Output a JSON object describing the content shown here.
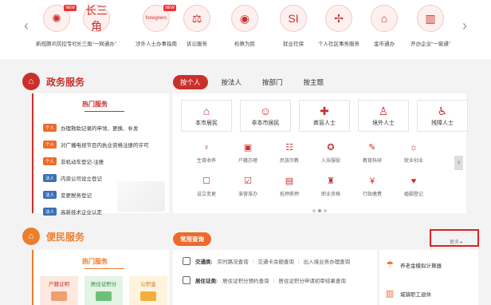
{
  "top_nav": {
    "prev_arrow": "‹",
    "next_arrow": "›",
    "items": [
      {
        "label": "新冠肺炎防控专栏",
        "icon": "virus-icon",
        "glyph": "✺",
        "badge": "NEW"
      },
      {
        "label": "长三角“一网通办”",
        "icon": "yangtze-delta-icon",
        "glyph": "长三角",
        "badge": ""
      },
      {
        "label": "涉外人士办事指南",
        "icon": "foreigners-icon",
        "glyph": "foreigners",
        "badge": "NEW"
      },
      {
        "label": "诉讼服务",
        "icon": "litigation-icon",
        "glyph": "⚖",
        "badge": ""
      },
      {
        "label": "检察为民",
        "icon": "procuratorate-icon",
        "glyph": "◉",
        "badge": ""
      },
      {
        "label": "就业社保",
        "icon": "social-security-icon",
        "glyph": "SI",
        "badge": ""
      },
      {
        "label": "个人社区事务服务",
        "icon": "community-icon",
        "glyph": "✢",
        "badge": ""
      },
      {
        "label": "金市通办",
        "icon": "city-service-icon",
        "glyph": "⌂",
        "badge": ""
      },
      {
        "label": "开办企业“一窗通”",
        "icon": "enterprise-icon",
        "glyph": "▥",
        "badge": ""
      }
    ]
  },
  "gov_section": {
    "title": "政务服务",
    "icon": "government-building-icon",
    "tabs": [
      "按个人",
      "按法人",
      "按部门",
      "按主题"
    ],
    "hot": {
      "title": "热门服务",
      "items": [
        {
          "tag": "个人",
          "kind": "person",
          "text": "办理救助记录的申领、更换、补发"
        },
        {
          "tag": "个人",
          "kind": "person",
          "text": "对广播电视节目内执业资格注册的许可"
        },
        {
          "tag": "个人",
          "kind": "person",
          "text": "非机动车登记-注册"
        },
        {
          "tag": "法人",
          "kind": "legal",
          "text": "内资公司设立登记"
        },
        {
          "tag": "法人",
          "kind": "legal",
          "text": "变更税务登记"
        },
        {
          "tag": "法人",
          "kind": "legal",
          "text": "高新技术企业认定"
        }
      ]
    },
    "big_cards": [
      {
        "label": "本市居民",
        "icon": "home-icon",
        "glyph": "⌂"
      },
      {
        "label": "非本市居民",
        "icon": "people-icon",
        "glyph": "☺"
      },
      {
        "label": "商盲人士",
        "icon": "briefcase-icon",
        "glyph": "✚"
      },
      {
        "label": "境外人士",
        "icon": "foreign-person-icon",
        "glyph": "♙"
      },
      {
        "label": "残障人士",
        "icon": "wheelchair-icon",
        "glyph": "♿"
      }
    ],
    "row1": [
      {
        "label": "生育收养",
        "icon": "stroller-icon",
        "glyph": "♀"
      },
      {
        "label": "户籍办理",
        "icon": "household-icon",
        "glyph": "▣"
      },
      {
        "label": "民族宗教",
        "icon": "ethnic-icon",
        "glyph": "☷"
      },
      {
        "label": "入伍服役",
        "icon": "military-icon",
        "glyph": "✪"
      },
      {
        "label": "教育科研",
        "icon": "education-icon",
        "glyph": "✎"
      },
      {
        "label": "就业创业",
        "icon": "employment-icon",
        "glyph": "☼"
      }
    ],
    "row2": [
      {
        "label": "设立变更",
        "icon": "register-icon",
        "glyph": "☐"
      },
      {
        "label": "准营准办",
        "icon": "license-icon",
        "glyph": "☑"
      },
      {
        "label": "抵押质押",
        "icon": "mortgage-icon",
        "glyph": "▤"
      },
      {
        "label": "职业资格",
        "icon": "qualification-icon",
        "glyph": "♜"
      },
      {
        "label": "行政缴费",
        "icon": "payment-icon",
        "glyph": "¥"
      },
      {
        "label": "婚姻登记",
        "icon": "marriage-icon",
        "glyph": "♥"
      }
    ],
    "grid_next": "›"
  },
  "convenience_section": {
    "title": "便民服务",
    "icon": "convenience-icon",
    "common_query": "常用查询",
    "more": "更多 ▸",
    "hot": {
      "title": "热门服务",
      "cards": [
        "户籍证明",
        "居住证积分",
        "公积金"
      ]
    },
    "queries": [
      {
        "category": "交通类:",
        "icon": "traffic-icon",
        "links": [
          "实时路况查询",
          "交通卡余额查询",
          "出入境业务办理查询"
        ]
      },
      {
        "category": "居住证类:",
        "icon": "residence-icon",
        "links": [
          "居住证积分预约查询",
          "居住证积分申请初审结果查询"
        ]
      }
    ],
    "side": [
      {
        "label": "养老金模拟计算器",
        "icon": "umbrella-icon",
        "glyph": "☂"
      },
      {
        "label": "城镇职工退休",
        "icon": "building-icon",
        "glyph": "▥"
      }
    ]
  }
}
